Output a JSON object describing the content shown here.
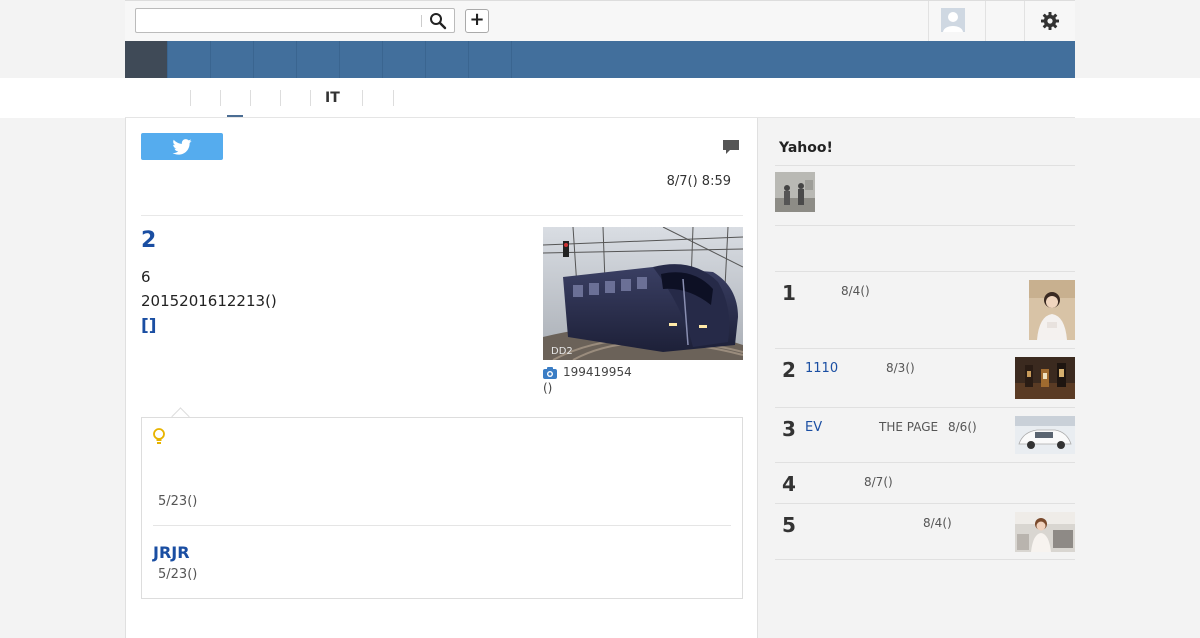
{
  "header": {
    "search": {
      "value": "",
      "placeholder": ""
    },
    "add_label": "+"
  },
  "subnav": {
    "active_label": "IT"
  },
  "article": {
    "date": "8/7() 8:59",
    "headline": "2",
    "line1": "6",
    "line2": "2015201612213()",
    "link": "[]",
    "photo_caption": "199419954",
    "photo_caption2": "()",
    "photo_watermark": "DD2"
  },
  "related_box": {
    "date1": "5/23()",
    "link2": "JRJR",
    "date2": "5/23()"
  },
  "sidebar": {
    "title": "Yahoo!",
    "ranking": [
      {
        "rank": "1",
        "link": "",
        "text": "8/4()"
      },
      {
        "rank": "2",
        "link": "1110",
        "text": "8/3()"
      },
      {
        "rank": "3",
        "link": "EV",
        "source": "THE PAGE",
        "text": "8/6()"
      },
      {
        "rank": "4",
        "link": "",
        "text": "8/7()"
      },
      {
        "rank": "5",
        "link": "",
        "text": "8/4()"
      }
    ]
  },
  "colors": {
    "navbar": "#426f9c",
    "nav_active": "#3f4a57",
    "link": "#1a4ea2",
    "tweet": "#55acee"
  }
}
